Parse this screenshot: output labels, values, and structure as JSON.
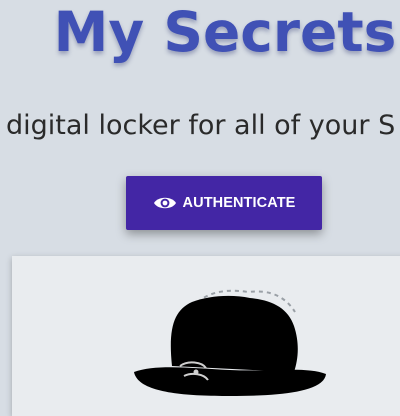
{
  "header": {
    "title": "My Secrets",
    "subtitle": "digital locker for all of your S"
  },
  "auth_button": {
    "label": "AUTHENTICATE",
    "icon": "eye-icon"
  },
  "card": {
    "image": "bowler-hat-icon"
  },
  "colors": {
    "background": "#d7dde4",
    "title": "#4051b5",
    "button": "#4326a5",
    "card": "#e9ecef"
  }
}
